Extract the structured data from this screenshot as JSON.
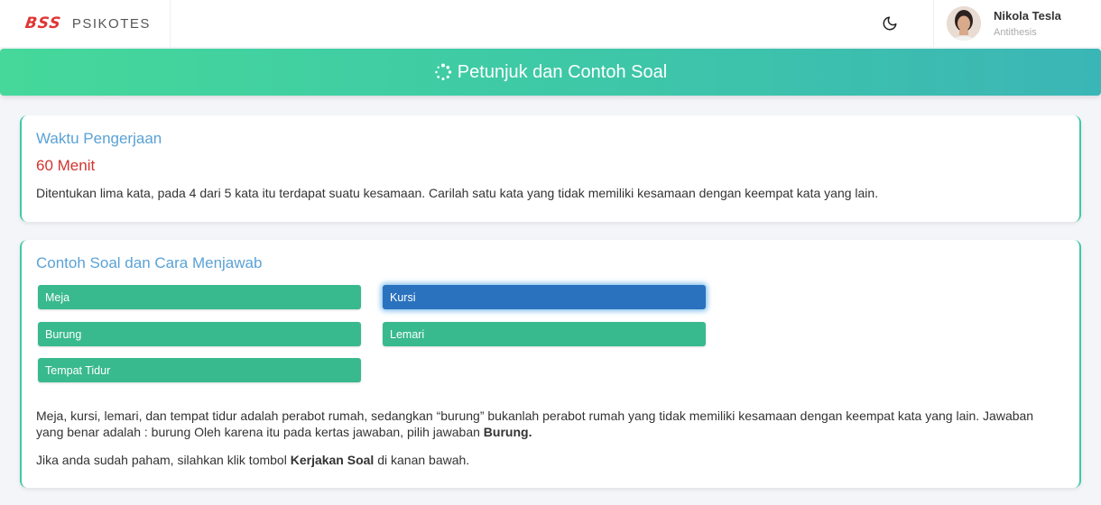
{
  "header": {
    "logo_text": "BSS",
    "brand_name": "PSIKOTES",
    "theme_icon": "moon-icon",
    "user": {
      "name": "Nikola Tesla",
      "role": "Antithesis"
    }
  },
  "banner": {
    "icon": "spinner-icon",
    "title": "Petunjuk dan Contoh Soal"
  },
  "time_card": {
    "title": "Waktu Pengerjaan",
    "duration": "60 Menit",
    "instruction": "Ditentukan lima kata, pada 4 dari 5 kata itu terdapat suatu kesamaan. Carilah satu kata yang tidak memiliki kesamaan dengan keempat kata yang lain."
  },
  "example_card": {
    "title": "Contoh Soal dan Cara Menjawab",
    "options": [
      {
        "label": "Meja",
        "selected": false
      },
      {
        "label": "Kursi",
        "selected": true
      },
      {
        "label": "Burung",
        "selected": false
      },
      {
        "label": "Lemari",
        "selected": false
      },
      {
        "label": "Tempat Tidur",
        "selected": false
      }
    ],
    "explanation_text": "Meja, kursi, lemari, dan tempat tidur adalah perabot rumah, sedangkan “burung” bukanlah perabot rumah yang tidak memiliki kesamaan dengan keempat kata yang lain. Jawaban yang benar adalah : burung Oleh karena itu pada kertas jawaban, pilih jawaban ",
    "explanation_bold": "Burung.",
    "closing_prefix": "Jika anda sudah paham, silahkan klik tombol ",
    "closing_bold": "Kerjakan Soal",
    "closing_suffix": " di kanan bawah."
  },
  "colors": {
    "accent_green": "#39b98e",
    "selected_blue": "#2a72be",
    "title_blue": "#5aa2d6",
    "time_red": "#d2352f"
  }
}
